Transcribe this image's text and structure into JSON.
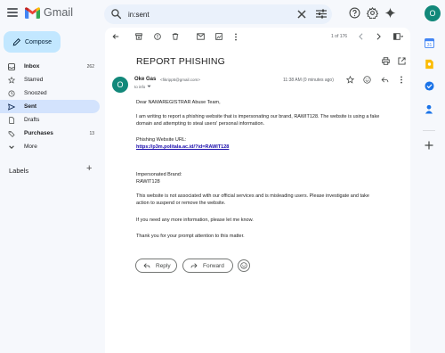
{
  "app": {
    "name": "Gmail",
    "avatar_letter": "O"
  },
  "search": {
    "value": "in:sent"
  },
  "sidebar": {
    "compose_label": "Compose",
    "items": [
      {
        "label": "Inbox",
        "count": "262"
      },
      {
        "label": "Starred",
        "count": ""
      },
      {
        "label": "Snoozed",
        "count": ""
      },
      {
        "label": "Sent",
        "count": ""
      },
      {
        "label": "Drafts",
        "count": ""
      },
      {
        "label": "Purchases",
        "count": "13"
      },
      {
        "label": "More",
        "count": ""
      }
    ],
    "labels_title": "Labels"
  },
  "toolbar": {
    "pager": "1 of 176"
  },
  "email": {
    "subject": "REPORT PHISHING",
    "sender_avatar": "O",
    "sender_name": "Oke Gas",
    "sender_email": "<fikripp5@gmail.com>",
    "to": "to info",
    "time": "11:38 AM (0 minutes ago)",
    "greeting": "Dear NAMAREGISTRAR Abuse Team,",
    "para1_line1": "I am writing to report a phishing website that is impersonating our brand, RAWIT128. The website is using a fake",
    "para1_line2": "domain and attempting to steal users' personal information.",
    "url_label": "Phishing Website URL:",
    "url": "https://p3m.politala.ac.id/?id=RAWIT128",
    "brand_label": "Impersonated Brand:",
    "brand": "RAWIT128",
    "para2_line1": "This website is not associated with our official services and is misleading users. Please investigate and take",
    "para2_line2": "action to suspend or remove the website.",
    "para3": "If you need any more information, please let me know.",
    "para4": "Thank you for your prompt attention to this matter."
  },
  "actions": {
    "reply": "Reply",
    "forward": "Forward"
  },
  "colors": {
    "accent": "#0b57d0",
    "avatar": "#12887a",
    "sent_highlight": "#d3e3fd",
    "compose": "#c2e7ff"
  },
  "icons": [
    "menu-icon",
    "search-icon",
    "clear-icon",
    "filter-icon",
    "help-icon",
    "settings-icon",
    "gemini-icon",
    "back-icon",
    "archive-icon",
    "report-icon",
    "delete-icon",
    "mark-unread-icon",
    "snooze-icon",
    "more-icon",
    "print-icon",
    "open-new-window-icon",
    "star-icon",
    "emoji-icon",
    "reply-icon",
    "forward-icon"
  ]
}
